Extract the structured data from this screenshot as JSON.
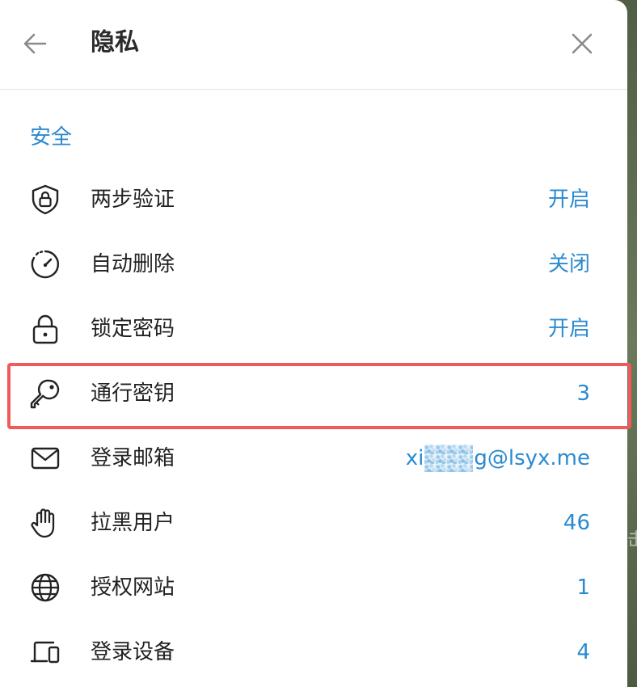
{
  "header": {
    "title": "隐私",
    "back_icon": "arrow-left-icon",
    "close_icon": "close-icon"
  },
  "security": {
    "section_title": "安全",
    "items": [
      {
        "icon": "shield-lock-icon",
        "label": "两步验证",
        "value": "开启"
      },
      {
        "icon": "timer-icon",
        "label": "自动删除",
        "value": "关闭"
      },
      {
        "icon": "lock-icon",
        "label": "锁定密码",
        "value": "开启"
      },
      {
        "icon": "key-icon",
        "label": "通行密钥",
        "value": "3"
      },
      {
        "icon": "mail-icon",
        "label": "登录邮箱",
        "value_prefix": "xi",
        "value_suffix": "g@lsyx.me"
      },
      {
        "icon": "hand-icon",
        "label": "拉黑用户",
        "value": "46"
      },
      {
        "icon": "globe-icon",
        "label": "授权网站",
        "value": "1"
      },
      {
        "icon": "devices-icon",
        "label": "登录设备",
        "value": "4"
      }
    ]
  },
  "colors": {
    "accent": "#2a8ad0",
    "highlight_border": "#f05a5a",
    "text": "#222222"
  }
}
